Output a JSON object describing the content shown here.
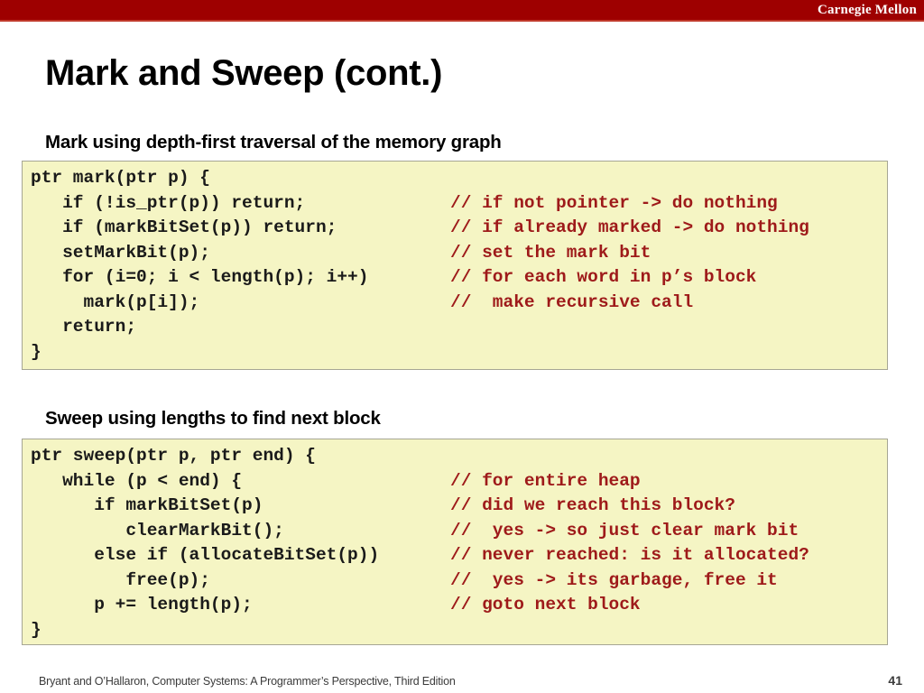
{
  "header": {
    "brand": "Carnegie Mellon",
    "band_color": "#9e0000",
    "rule_color": "#c0392b"
  },
  "title": "Mark and Sweep (cont.)",
  "bullets": {
    "mark": "Mark using depth-first traversal of the memory graph",
    "sweep": "Sweep using lengths to find next block"
  },
  "code_style": {
    "background": "#f5f5c4",
    "border": "#a6a694",
    "text_color": "#1a1a1a",
    "comment_color": "#9e1a1a"
  },
  "code_mark": [
    {
      "code": "ptr mark(ptr p) {",
      "comment": ""
    },
    {
      "code": "   if (!is_ptr(p)) return;",
      "comment": "// if not pointer -> do nothing"
    },
    {
      "code": "   if (markBitSet(p)) return;",
      "comment": "// if already marked -> do nothing"
    },
    {
      "code": "   setMarkBit(p);",
      "comment": "// set the mark bit"
    },
    {
      "code": "   for (i=0; i < length(p); i++)",
      "comment": "// for each word in p’s block"
    },
    {
      "code": "     mark(p[i]);",
      "comment": "//  make recursive call"
    },
    {
      "code": "   return;",
      "comment": ""
    },
    {
      "code": "}",
      "comment": ""
    }
  ],
  "code_sweep": [
    {
      "code": "ptr sweep(ptr p, ptr end) {",
      "comment": ""
    },
    {
      "code": "   while (p < end) {",
      "comment": "// for entire heap"
    },
    {
      "code": "      if markBitSet(p)",
      "comment": "// did we reach this block?"
    },
    {
      "code": "         clearMarkBit();",
      "comment": "//  yes -> so just clear mark bit"
    },
    {
      "code": "      else if (allocateBitSet(p))",
      "comment": "// never reached: is it allocated?"
    },
    {
      "code": "         free(p);",
      "comment": "//  yes -> its garbage, free it"
    },
    {
      "code": "      p += length(p);",
      "comment": "// goto next block"
    },
    {
      "code": "}",
      "comment": ""
    }
  ],
  "footer": {
    "citation": "Bryant and O’Hallaron, Computer Systems: A Programmer’s Perspective, Third Edition",
    "page_number": "41"
  }
}
